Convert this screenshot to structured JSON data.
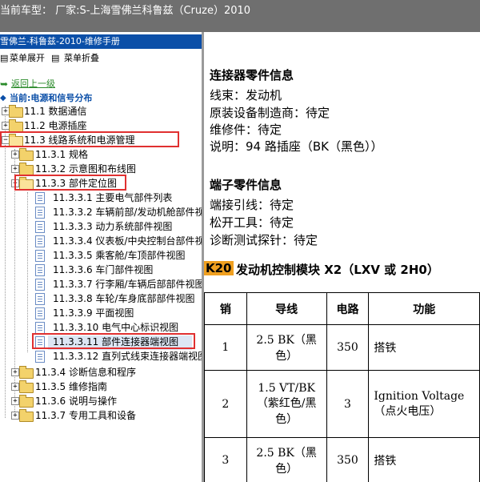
{
  "window": {
    "title": "当前车型： 厂家:S-上海雪佛兰科鲁兹（Cruze）2010"
  },
  "left": {
    "header": "雪佛兰-科鲁兹-2010-维修手册",
    "expand": "菜单展开",
    "collapse": "菜单折叠",
    "back": "返回上一级",
    "current": "当前:电源和信号分布",
    "tree": [
      {
        "label": "11.1 数据通信"
      },
      {
        "label": "11.2 电源插座"
      },
      {
        "label": "11.3 线路系统和电源管理"
      },
      {
        "label": "11.3.1 规格"
      },
      {
        "label": "11.3.2 示意图和布线图"
      },
      {
        "label": "11.3.3 部件定位图"
      },
      {
        "label": "11.3.3.1 主要电气部件列表"
      },
      {
        "label": "11.3.3.2 车辆前部/发动机舱部件视图"
      },
      {
        "label": "11.3.3.3 动力系统部件视图"
      },
      {
        "label": "11.3.3.4 仪表板/中央控制台部件视图"
      },
      {
        "label": "11.3.3.5 乘客舱/车顶部件视图"
      },
      {
        "label": "11.3.3.6 车门部件视图"
      },
      {
        "label": "11.3.3.7 行李厢/车辆后部部件视图"
      },
      {
        "label": "11.3.3.8 车轮/车身底部部件视图"
      },
      {
        "label": "11.3.3.9 平面视图"
      },
      {
        "label": "11.3.3.10 电气中心标识视图"
      },
      {
        "label": "11.3.3.11 部件连接器端视图"
      },
      {
        "label": "11.3.3.12 直列式线束连接器端视图"
      },
      {
        "label": "11.3.4 诊断信息和程序"
      },
      {
        "label": "11.3.5 维修指南"
      },
      {
        "label": "11.3.6 说明与操作"
      },
      {
        "label": "11.3.7 专用工具和设备"
      }
    ]
  },
  "right": {
    "connector_heading": "连接器零件信息",
    "harness": "线束：发动机",
    "oem": "原装设备制造商：待定",
    "service_part": "维修件：待定",
    "desc": "说明：94 路插座（BK（黑色））",
    "terminal_heading": "端子零件信息",
    "terminal_lead": "端接引线：待定",
    "release_tool": "松开工具：待定",
    "probe": "诊断测试探针：待定",
    "module_tag": "K20",
    "module_title": "发动机控制模块 X2（LXV 或 2H0）",
    "table": {
      "headers": [
        "销",
        "导线",
        "电路",
        "功能"
      ],
      "rows": [
        {
          "pin": "1",
          "wire": "2.5 BK（黑色）",
          "circuit": "350",
          "function": "搭铁"
        },
        {
          "pin": "2",
          "wire": "1.5 VT/BK（紫红色/黑色）",
          "circuit": "3",
          "function": "Ignition Voltage（点火电压）"
        },
        {
          "pin": "3",
          "wire": "2.5 BK（黑色）",
          "circuit": "350",
          "function": "搭铁"
        }
      ]
    }
  },
  "colors": {
    "titlebar": "#6f6f6f",
    "header": "#0b4fa8",
    "highlight": "#e03030",
    "k20": "#f0a020"
  }
}
